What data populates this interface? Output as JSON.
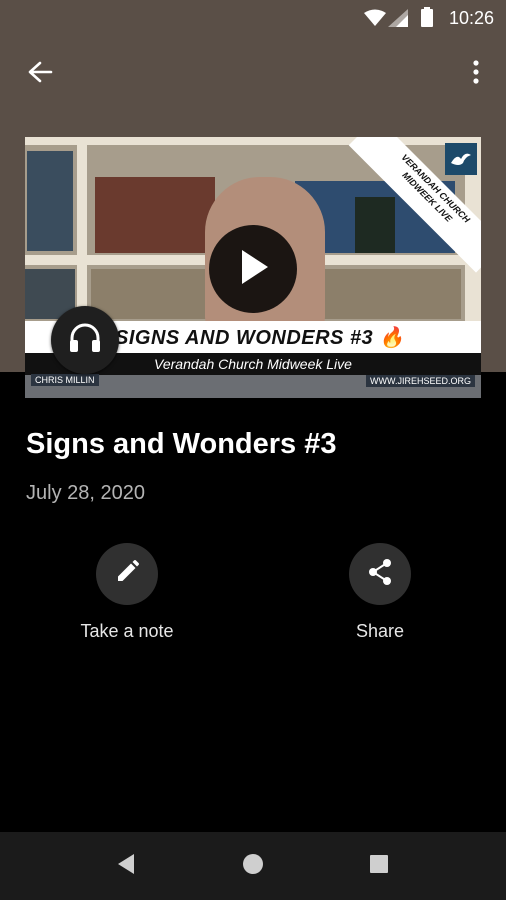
{
  "status_bar": {
    "time": "10:26"
  },
  "toolbar": {
    "back_icon": "arrow-back-icon",
    "menu_icon": "more-vert-icon"
  },
  "video": {
    "thumbnail_title": "SIGNS AND WONDERS #3 🔥",
    "thumbnail_subtitle": "Verandah Church Midweek Live",
    "corner_line1": "VERANDAH CHURCH",
    "corner_line2": "MIDWEEK LIVE",
    "presenter": "CHRIS MILLIN",
    "website": "WWW.JIREHSEED.ORG"
  },
  "details": {
    "title": "Signs and Wonders #3",
    "date": "July 28, 2020"
  },
  "actions": [
    {
      "label": "Take a note",
      "icon": "pencil-icon"
    },
    {
      "label": "Share",
      "icon": "share-icon"
    }
  ],
  "colors": {
    "header": "#5a4f47",
    "background": "#000000",
    "action_circle": "#303030",
    "nav_bar": "#1b1b1b"
  }
}
